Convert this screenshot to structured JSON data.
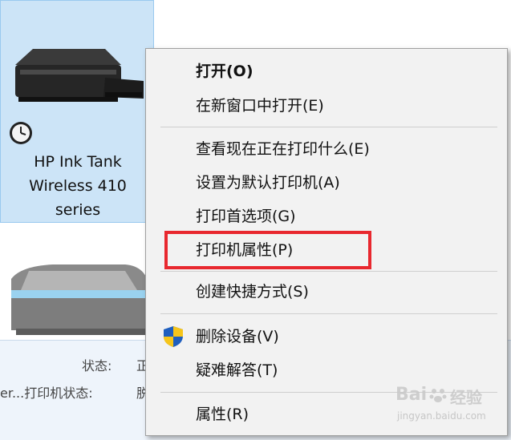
{
  "printer": {
    "name_lines": [
      "HP Ink Tank",
      "Wireless 410",
      "series"
    ]
  },
  "details": {
    "status_label": "状态:",
    "status_value": "正",
    "printer_status_label": "er...打印机状态:",
    "printer_status_value": "脱"
  },
  "menu": {
    "items": [
      {
        "label": "打开(O)"
      },
      {
        "label": "在新窗口中打开(E)"
      },
      {
        "label": "查看现在正在打印什么(E)"
      },
      {
        "label": "设置为默认打印机(A)"
      },
      {
        "label": "打印首选项(G)"
      },
      {
        "label": "打印机属性(P)"
      },
      {
        "label": "创建快捷方式(S)"
      },
      {
        "label": "删除设备(V)"
      },
      {
        "label": "疑难解答(T)"
      },
      {
        "label": "属性(R)"
      }
    ]
  },
  "watermark": {
    "brand": "Bai",
    "brand_suffix": "经验",
    "url": "jingyan.baidu.com"
  },
  "colors": {
    "selection": "#cce4f7",
    "highlight_box": "#e8282f",
    "menu_bg": "#f2f2f2"
  }
}
